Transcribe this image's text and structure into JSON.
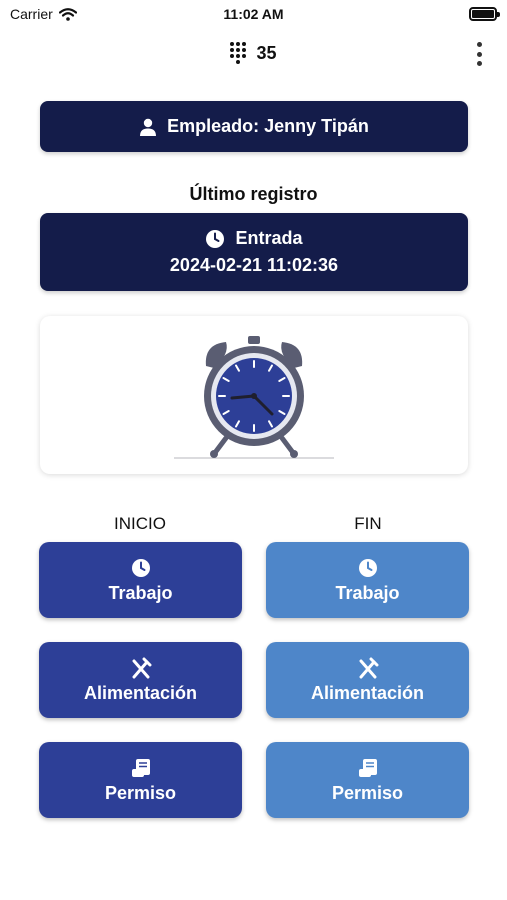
{
  "status_bar": {
    "carrier": "Carrier",
    "time": "11:02 AM",
    "icons": [
      "wifi-icon",
      "battery-icon"
    ]
  },
  "nav": {
    "count": "35",
    "icons": [
      "keypad-icon",
      "more-vertical-icon"
    ]
  },
  "employee": {
    "label": "Empleado: Jenny Tipán",
    "icon": "user-icon"
  },
  "last_record": {
    "title": "Último registro",
    "type": "Entrada",
    "datetime": "2024-02-21 11:02:36",
    "icon": "clock-icon"
  },
  "illustration": {
    "icon": "alarm-clock-illustration"
  },
  "columns": {
    "start_label": "INICIO",
    "end_label": "FIN"
  },
  "actions": {
    "start": [
      {
        "label": "Trabajo",
        "icon": "clock-icon"
      },
      {
        "label": "Alimentación",
        "icon": "utensils-icon"
      },
      {
        "label": "Permiso",
        "icon": "document-icon"
      }
    ],
    "end": [
      {
        "label": "Trabajo",
        "icon": "clock-icon"
      },
      {
        "label": "Alimentación",
        "icon": "utensils-icon"
      },
      {
        "label": "Permiso",
        "icon": "document-icon"
      }
    ]
  },
  "colors": {
    "dark_navy": "#141c4a",
    "start_blue": "#2d3f97",
    "end_blue": "#4e86c9"
  }
}
